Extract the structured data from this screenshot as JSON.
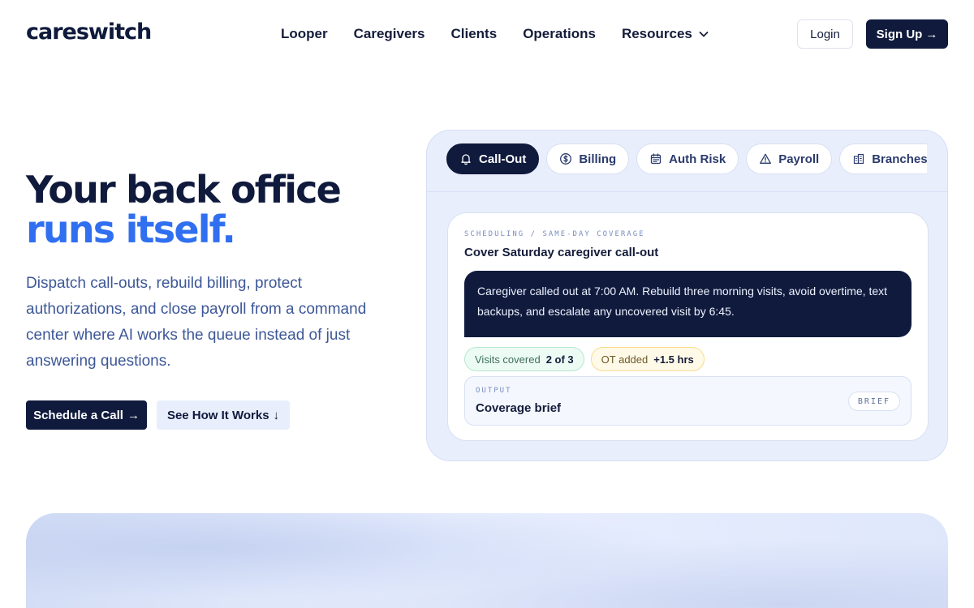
{
  "brand": {
    "logo_text": "careswitch"
  },
  "nav": {
    "links": [
      "Looper",
      "Caregivers",
      "Clients",
      "Operations",
      "Resources"
    ],
    "login_label": "Login",
    "signup_label": "Sign Up"
  },
  "hero": {
    "title_line1": "Your back office",
    "title_line2": "runs itself.",
    "description": "Dispatch call-outs, rebuild billing, protect authorizations, and close payroll from a command center where AI works the queue instead of just answering questions.",
    "primary_cta": "Schedule a Call",
    "secondary_cta": "See How It Works"
  },
  "panel": {
    "tabs": [
      {
        "label": "Call-Out",
        "icon": "bell-icon",
        "active": true
      },
      {
        "label": "Billing",
        "icon": "dollar-circle-icon",
        "active": false
      },
      {
        "label": "Auth Risk",
        "icon": "calendar-icon",
        "active": false
      },
      {
        "label": "Payroll",
        "icon": "warning-triangle-icon",
        "active": false
      },
      {
        "label": "Branches",
        "icon": "building-icon",
        "active": false
      }
    ],
    "card": {
      "eyebrow": "SCHEDULING / SAME-DAY COVERAGE",
      "title": "Cover Saturday caregiver call-out",
      "message": "Caregiver called out at 7:00 AM. Rebuild three morning visits, avoid overtime, text backups, and escalate any uncovered visit by 6:45.",
      "chips": [
        {
          "label": "Visits covered",
          "value": "2 of 3",
          "tone": "green"
        },
        {
          "label": "OT added",
          "value": "+1.5 hrs",
          "tone": "yellow"
        }
      ],
      "output": {
        "label": "OUTPUT",
        "title": "Coverage brief",
        "badge": "BRIEF"
      }
    }
  },
  "colors": {
    "navy": "#0f1a3c",
    "accent_blue": "#2f6ff0",
    "body_blue": "#3d5797",
    "panel_bg": "#e9eefc"
  }
}
